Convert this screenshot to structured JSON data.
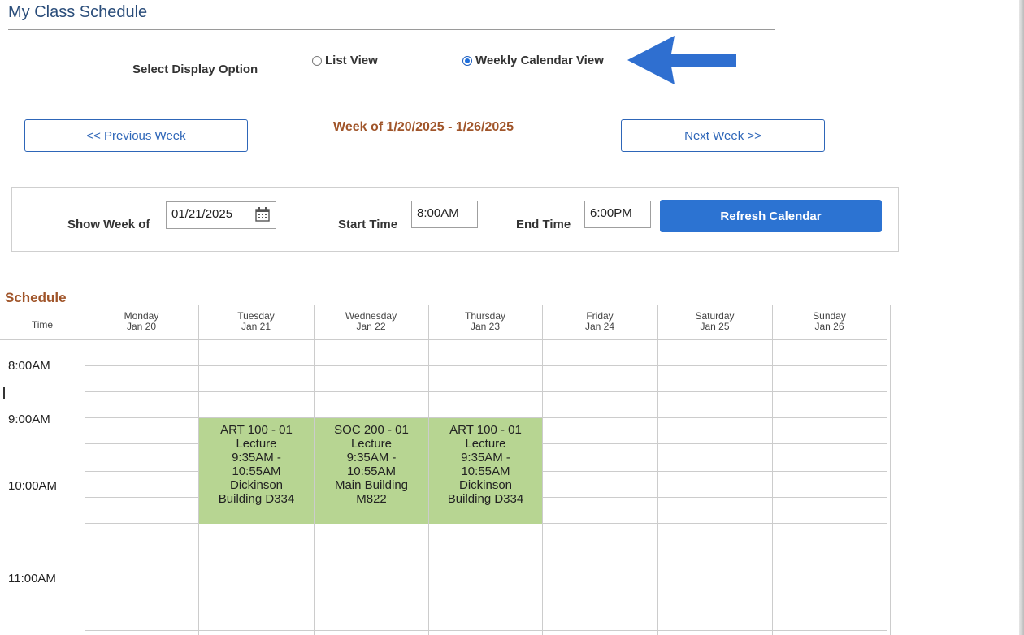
{
  "page": {
    "title": "My Class Schedule"
  },
  "display": {
    "label": "Select Display Option",
    "options": [
      "List View",
      "Weekly Calendar View"
    ],
    "selected": "Weekly Calendar View"
  },
  "week_nav": {
    "prev_label": "<< Previous Week",
    "title": "Week of 1/20/2025 - 1/26/2025",
    "next_label": "Next Week >>"
  },
  "filters": {
    "show_week_label": "Show Week of",
    "show_week_value": "01/21/2025",
    "start_label": "Start Time",
    "start_value": "8:00AM",
    "end_label": "End Time",
    "end_value": "6:00PM",
    "refresh_label": "Refresh Calendar"
  },
  "schedule": {
    "label": "Schedule",
    "time_header": "Time",
    "days": [
      {
        "name": "Monday",
        "date": "Jan 20"
      },
      {
        "name": "Tuesday",
        "date": "Jan 21"
      },
      {
        "name": "Wednesday",
        "date": "Jan 22"
      },
      {
        "name": "Thursday",
        "date": "Jan 23"
      },
      {
        "name": "Friday",
        "date": "Jan 24"
      },
      {
        "name": "Saturday",
        "date": "Jan 25"
      },
      {
        "name": "Sunday",
        "date": "Jan 26"
      }
    ],
    "times": [
      "8:00AM",
      "9:00AM",
      "10:00AM",
      "11:00AM"
    ],
    "events": [
      {
        "course": "ART 100 - 01",
        "type": "Lecture",
        "time1": "9:35AM -",
        "time2": "10:55AM",
        "loc1": "Dickinson",
        "loc2": "Building D334"
      },
      {
        "course": "SOC 200 - 01",
        "type": "Lecture",
        "time1": "9:35AM -",
        "time2": "10:55AM",
        "loc1": "Main Building",
        "loc2": "M822"
      },
      {
        "course": "ART 100 - 01",
        "type": "Lecture",
        "time1": "9:35AM -",
        "time2": "10:55AM",
        "loc1": "Dickinson",
        "loc2": "Building D334"
      }
    ]
  },
  "colors": {
    "accent": "#2c73d2",
    "heading": "#a0552a",
    "event_bg": "#b7d592",
    "arrow": "#2f6fd0"
  }
}
